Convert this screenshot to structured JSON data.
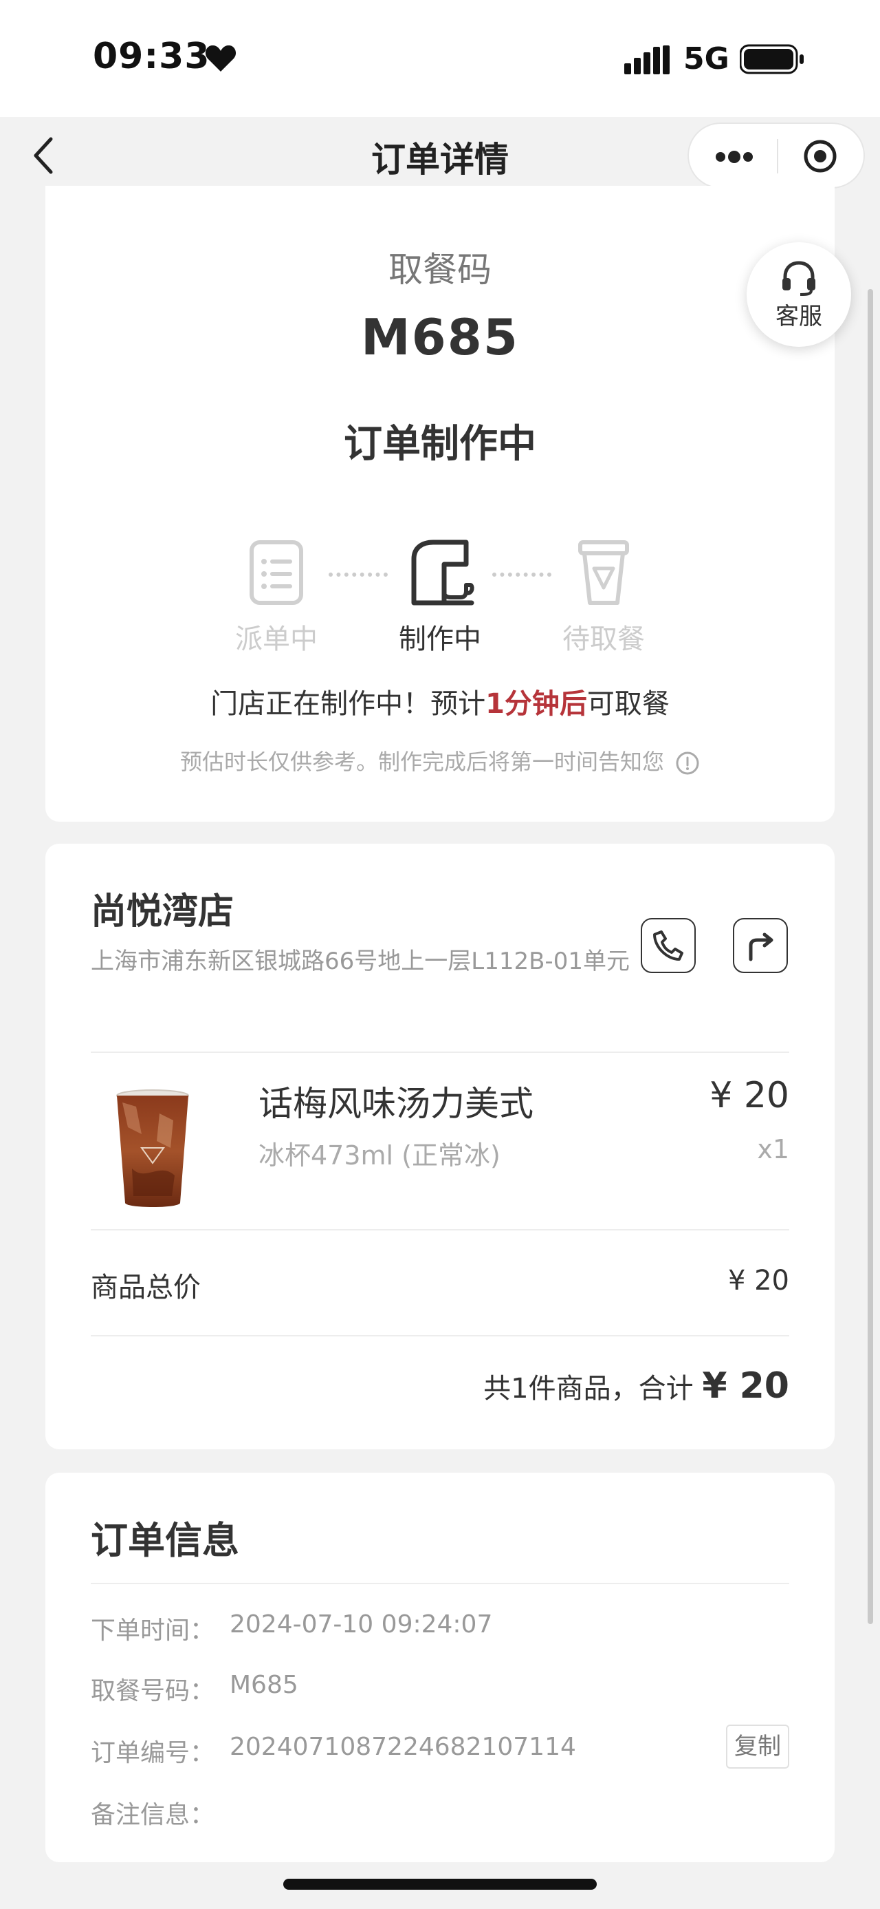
{
  "status_bar": {
    "time": "09:33",
    "network": "5G"
  },
  "nav": {
    "title": "订单详情"
  },
  "pickup": {
    "label": "取餐码",
    "code": "M685",
    "status": "订单制作中",
    "steps": [
      {
        "label": "派单中",
        "state": "done"
      },
      {
        "label": "制作中",
        "state": "active"
      },
      {
        "label": "待取餐",
        "state": "pending"
      }
    ],
    "message_prefix": "门店正在制作中！预计",
    "message_highlight": "1分钟后",
    "message_suffix": "可取餐",
    "disclaimer": "预估时长仅供参考。制作完成后将第一时间告知您"
  },
  "customer_service": {
    "label": "客服"
  },
  "store": {
    "name": "尚悦湾店",
    "address": "上海市浦东新区银城路66号地上一层L112B-01单元"
  },
  "product": {
    "name": "话梅风味汤力美式",
    "spec": "冰杯473ml (正常冰)",
    "price": "¥ 20",
    "qty": "x1"
  },
  "summary": {
    "subtotal_label": "商品总价",
    "subtotal_value": "¥ 20",
    "total_prefix": "共1件商品，合计",
    "total_amount": "¥ 20"
  },
  "order_info": {
    "title": "订单信息",
    "rows": [
      {
        "label": "下单时间：",
        "value": "2024-07-10 09:24:07"
      },
      {
        "label": "取餐号码：",
        "value": "M685"
      },
      {
        "label": "订单编号：",
        "value": "2024071087224682107114"
      },
      {
        "label": "备注信息：",
        "value": ""
      }
    ],
    "copy_label": "复制"
  },
  "colors": {
    "accent_red": "#b6343a",
    "background": "#f2f2f2"
  }
}
